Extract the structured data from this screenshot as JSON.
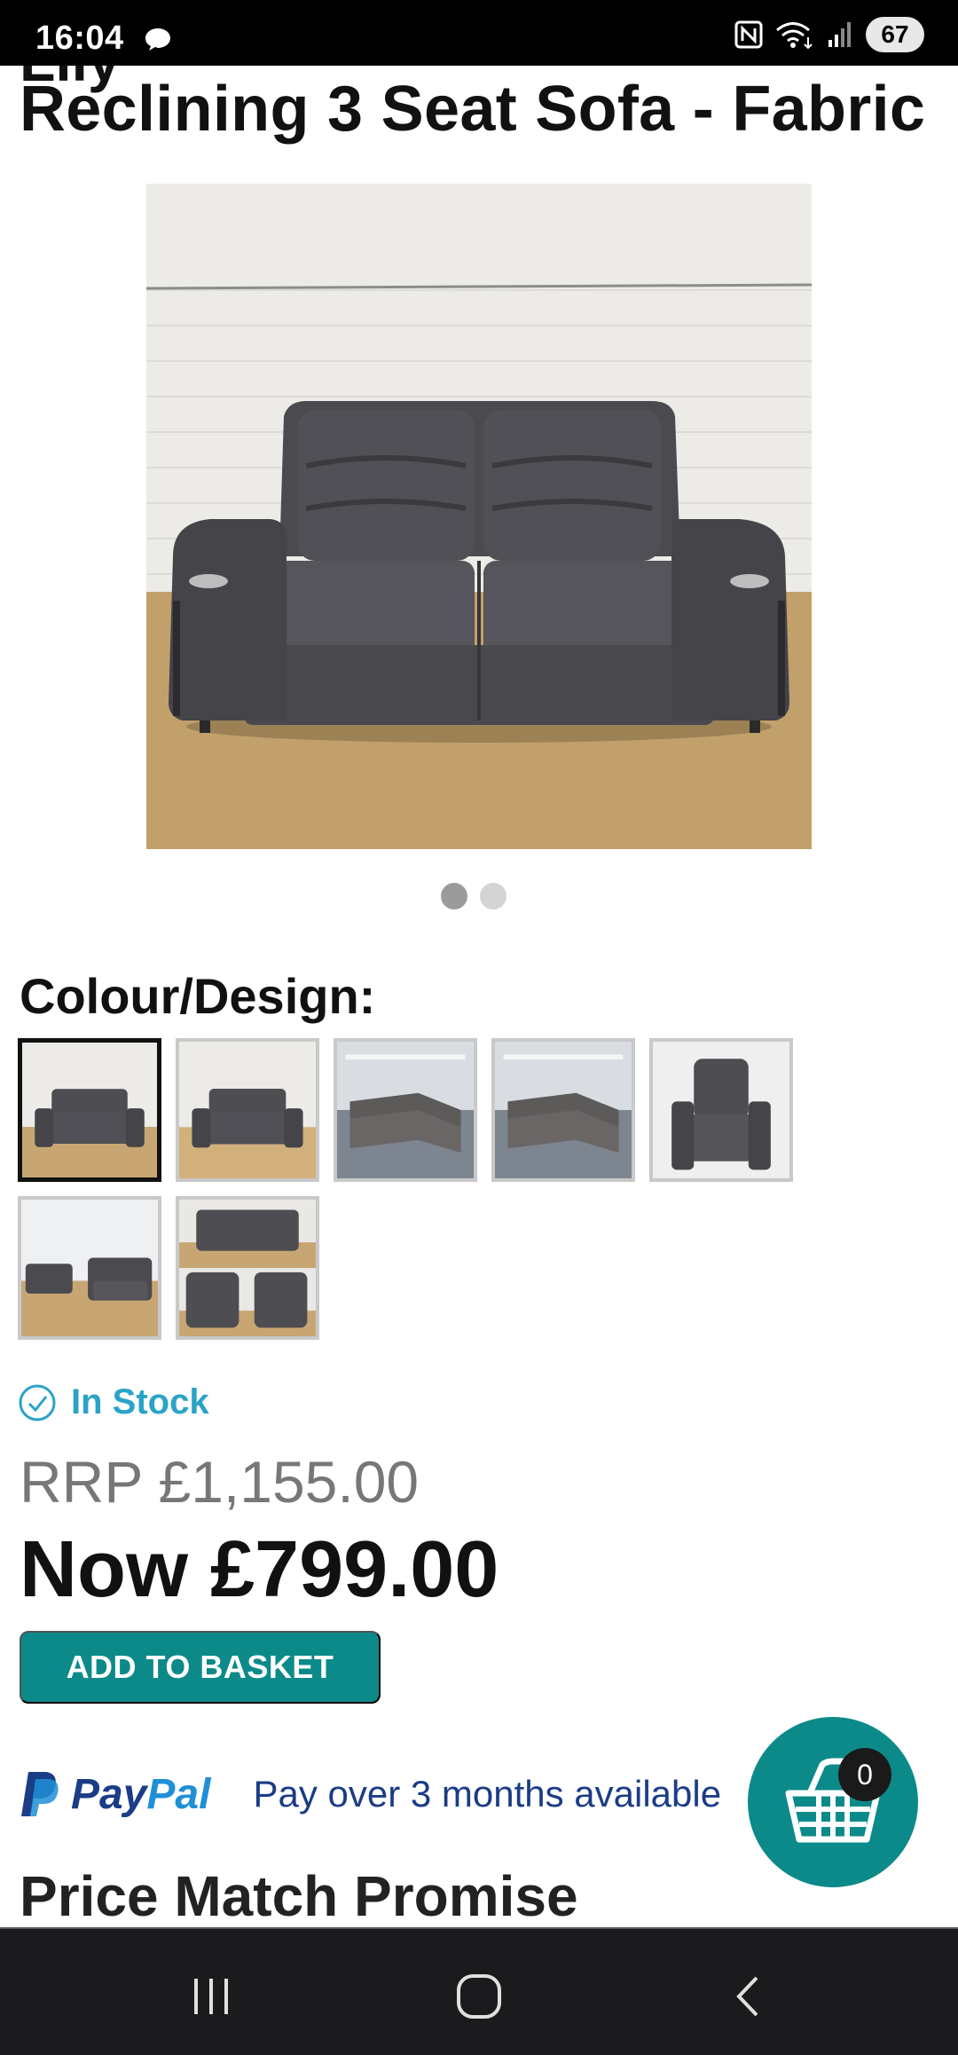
{
  "status_bar": {
    "time": "16:04",
    "battery": "67",
    "icons": [
      "chat-bubble-icon",
      "nfc-icon",
      "wifi-icon",
      "signal-icon",
      "battery-icon"
    ]
  },
  "product": {
    "title_partial": "Lily",
    "title": "Reclining 3 Seat Sofa - Fabric",
    "image_count": 2,
    "active_image": 1
  },
  "colour_label": "Colour/Design:",
  "swatches": [
    {
      "id": 1,
      "selected": true
    },
    {
      "id": 2,
      "selected": false
    },
    {
      "id": 3,
      "selected": false
    },
    {
      "id": 4,
      "selected": false
    },
    {
      "id": 5,
      "selected": false
    },
    {
      "id": 6,
      "selected": false
    },
    {
      "id": 7,
      "selected": false
    }
  ],
  "stock": {
    "label": "In Stock",
    "color": "#2aa3c7"
  },
  "pricing": {
    "rrp": "RRP £1,155.00",
    "now": "Now £799.00"
  },
  "add_to_basket": "ADD TO BASKET",
  "paypal": {
    "pay": "Pay",
    "pal": "Pal",
    "text": "Pay over 3 months available"
  },
  "section_heading": "Price Match Promise",
  "cart": {
    "count": "0"
  },
  "colors": {
    "accent_teal": "#0c8a8a",
    "stock_blue": "#2aa3c7",
    "paypal_navy": "#1b3c87",
    "paypal_light": "#1f8fd6"
  },
  "nav": {
    "icons": [
      "recents-icon",
      "home-icon",
      "back-icon"
    ]
  }
}
